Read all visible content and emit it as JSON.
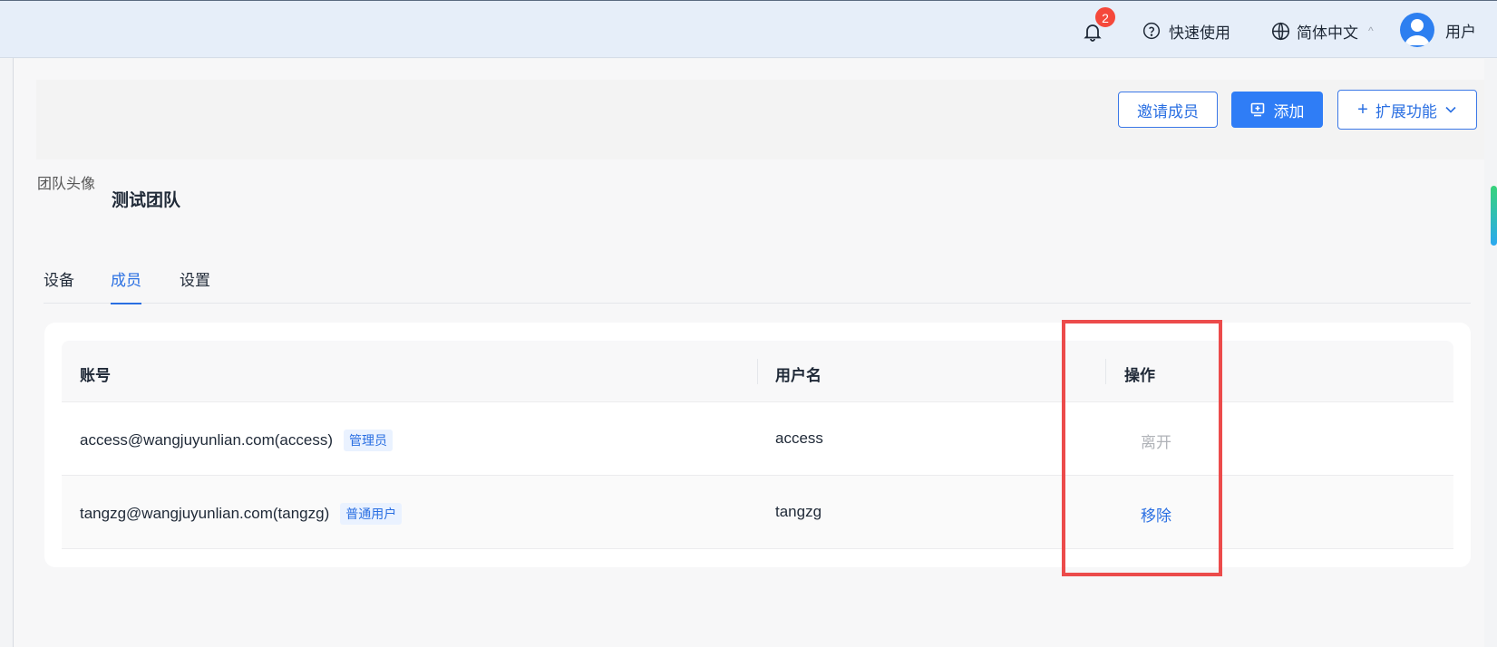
{
  "header": {
    "notification_count": "2",
    "quick_start_label": "快速使用",
    "language_label": "简体中文",
    "language_caret": "^",
    "user_label": "用户"
  },
  "toolbar": {
    "invite_label": "邀请成员",
    "add_label": "添加",
    "extend_label": "扩展功能"
  },
  "team": {
    "avatar_alt": "团队头像",
    "name": "测试团队"
  },
  "tabs": [
    {
      "label": "设备"
    },
    {
      "label": "成员"
    },
    {
      "label": "设置"
    }
  ],
  "table": {
    "columns": [
      "账号",
      "用户名",
      "操作"
    ],
    "rows": [
      {
        "account": "access@wangjuyunlian.com(access)",
        "role": "管理员",
        "username": "access",
        "action": "离开"
      },
      {
        "account": "tangzg@wangjuyunlian.com(tangzg)",
        "role": "普通用户",
        "username": "tangzg",
        "action": "移除"
      }
    ]
  },
  "colors": {
    "accent": "#2f7df6",
    "highlight": "#ec4b4b",
    "badge": "#f5483b"
  }
}
